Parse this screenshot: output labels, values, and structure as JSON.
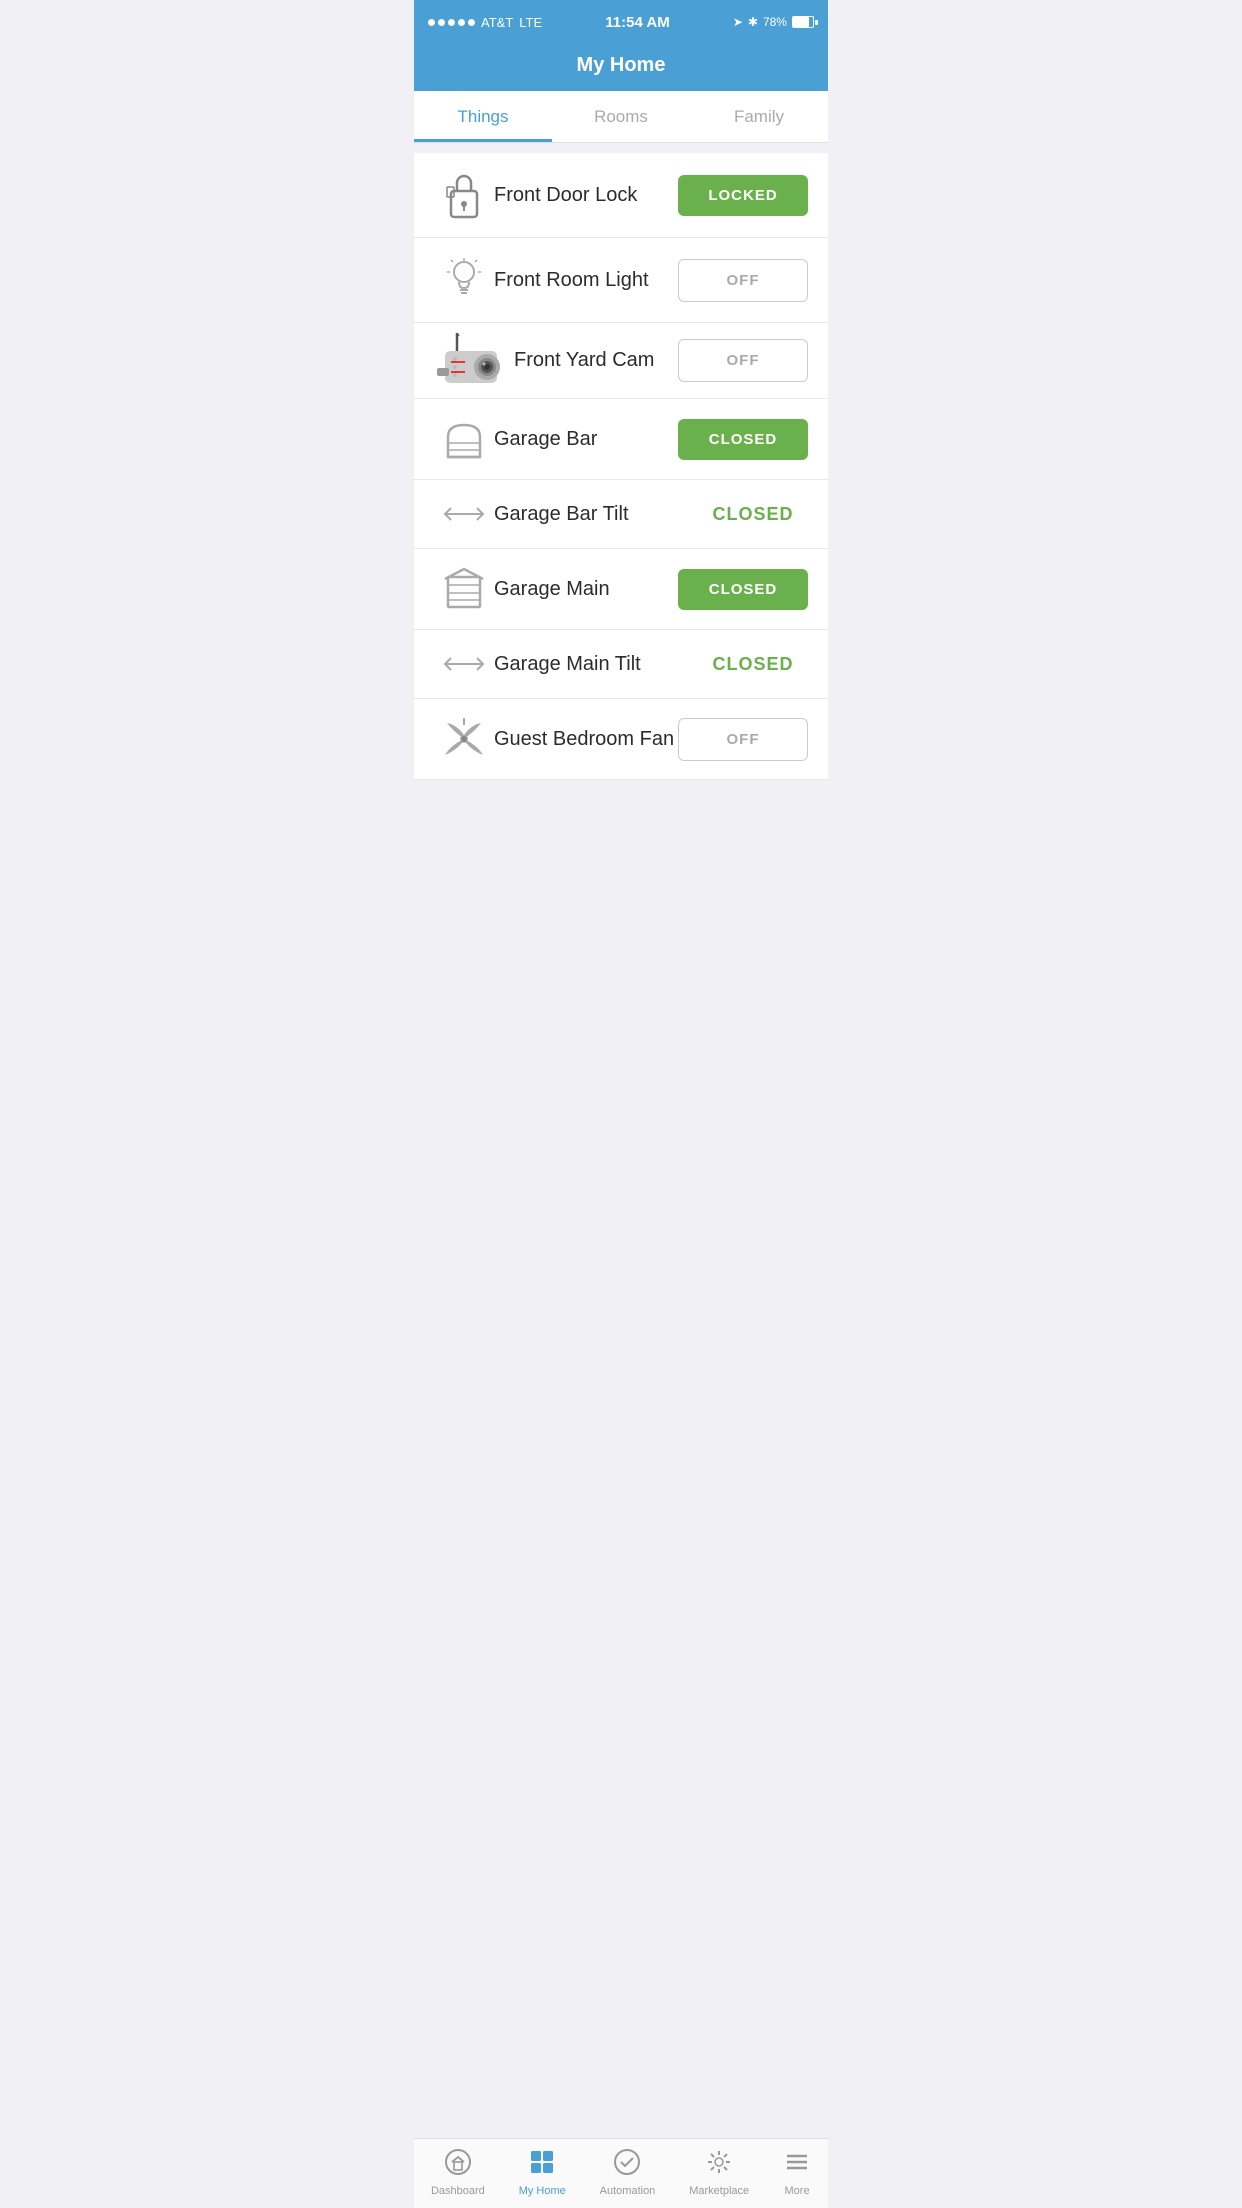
{
  "statusBar": {
    "carrier": "AT&T",
    "network": "LTE",
    "time": "11:54 AM",
    "battery": "78%"
  },
  "header": {
    "title": "My Home"
  },
  "tabs": [
    {
      "id": "things",
      "label": "Things",
      "active": true
    },
    {
      "id": "rooms",
      "label": "Rooms",
      "active": false
    },
    {
      "id": "family",
      "label": "Family",
      "active": false
    }
  ],
  "items": [
    {
      "id": "front-door-lock",
      "name": "Front Door Lock",
      "icon": "door-lock",
      "statusType": "btn-locked",
      "statusLabel": "LOCKED"
    },
    {
      "id": "front-room-light",
      "name": "Front Room Light",
      "icon": "light-bulb",
      "statusType": "btn-off",
      "statusLabel": "OFF"
    },
    {
      "id": "front-yard-cam",
      "name": "Front Yard Cam",
      "icon": "camera",
      "statusType": "btn-off",
      "statusLabel": "OFF"
    },
    {
      "id": "garage-bar",
      "name": "Garage Bar",
      "icon": "garage",
      "statusType": "btn-closed",
      "statusLabel": "CLOSED"
    },
    {
      "id": "garage-bar-tilt",
      "name": "Garage Bar Tilt",
      "icon": "tilt-sensor",
      "statusType": "text-closed",
      "statusLabel": "CLOSED"
    },
    {
      "id": "garage-main",
      "name": "Garage Main",
      "icon": "garage",
      "statusType": "btn-closed",
      "statusLabel": "CLOSED"
    },
    {
      "id": "garage-main-tilt",
      "name": "Garage Main Tilt",
      "icon": "tilt-sensor",
      "statusType": "text-closed",
      "statusLabel": "CLOSED"
    },
    {
      "id": "guest-bedroom-fan",
      "name": "Guest Bedroom Fan",
      "icon": "fan",
      "statusType": "btn-off",
      "statusLabel": "OFF"
    }
  ],
  "bottomNav": [
    {
      "id": "dashboard",
      "label": "Dashboard",
      "icon": "home-icon",
      "active": false
    },
    {
      "id": "my-home",
      "label": "My Home",
      "icon": "grid-icon",
      "active": true
    },
    {
      "id": "automation",
      "label": "Automation",
      "icon": "check-circle-icon",
      "active": false
    },
    {
      "id": "marketplace",
      "label": "Marketplace",
      "icon": "sparkle-icon",
      "active": false
    },
    {
      "id": "more",
      "label": "More",
      "icon": "menu-icon",
      "active": false
    }
  ],
  "colors": {
    "accent": "#4a9fd4",
    "green": "#6ab04c",
    "textDark": "#2c2c2c",
    "textGray": "#aaa"
  }
}
